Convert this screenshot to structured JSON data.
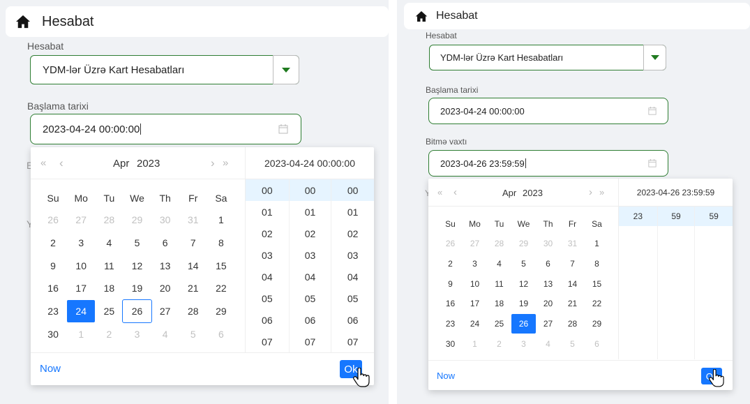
{
  "header": {
    "title": "Hesabat"
  },
  "report_field": {
    "label": "Hesabat",
    "value": "YDM-lər Üzrə Kart Hesabatları"
  },
  "start_field": {
    "label": "Başlama tarixi",
    "value": "2023-04-24 00:00:00"
  },
  "end_field": {
    "label": "Bitmə vaxtı",
    "value": "2023-04-26 23:59:59"
  },
  "calendar": {
    "month": "Apr",
    "year": "2023",
    "weekdays": [
      "Su",
      "Mo",
      "Tu",
      "We",
      "Th",
      "Fr",
      "Sa"
    ],
    "days": [
      "26",
      "27",
      "28",
      "29",
      "30",
      "31",
      "1",
      "2",
      "3",
      "4",
      "5",
      "6",
      "7",
      "8",
      "9",
      "10",
      "11",
      "12",
      "13",
      "14",
      "15",
      "16",
      "17",
      "18",
      "19",
      "20",
      "21",
      "22",
      "23",
      "24",
      "25",
      "26",
      "27",
      "28",
      "29",
      "30",
      "1",
      "2",
      "3",
      "4",
      "5",
      "6"
    ],
    "nav": {
      "super_prev": "«",
      "prev": "‹",
      "next": "›",
      "super_next": "»"
    }
  },
  "left_picker": {
    "time_header": "2023-04-24 00:00:00",
    "hours": [
      "00",
      "01",
      "02",
      "03",
      "04",
      "05",
      "06",
      "07"
    ],
    "minutes": [
      "00",
      "01",
      "02",
      "03",
      "04",
      "05",
      "06",
      "07"
    ],
    "seconds": [
      "00",
      "01",
      "02",
      "03",
      "04",
      "05",
      "06",
      "07"
    ],
    "selected_day_index": 29,
    "today_index": 31
  },
  "right_picker": {
    "time_header": "2023-04-26 23:59:59",
    "hours": [
      "23"
    ],
    "minutes": [
      "59"
    ],
    "seconds": [
      "59"
    ],
    "selected_day_index": 31
  },
  "footer": {
    "now_label": "Now",
    "ok_label": "Ok"
  },
  "colors": {
    "accent": "#1677ff",
    "border_green": "#2e7d32",
    "selected_bg": "#e6f4ff"
  }
}
